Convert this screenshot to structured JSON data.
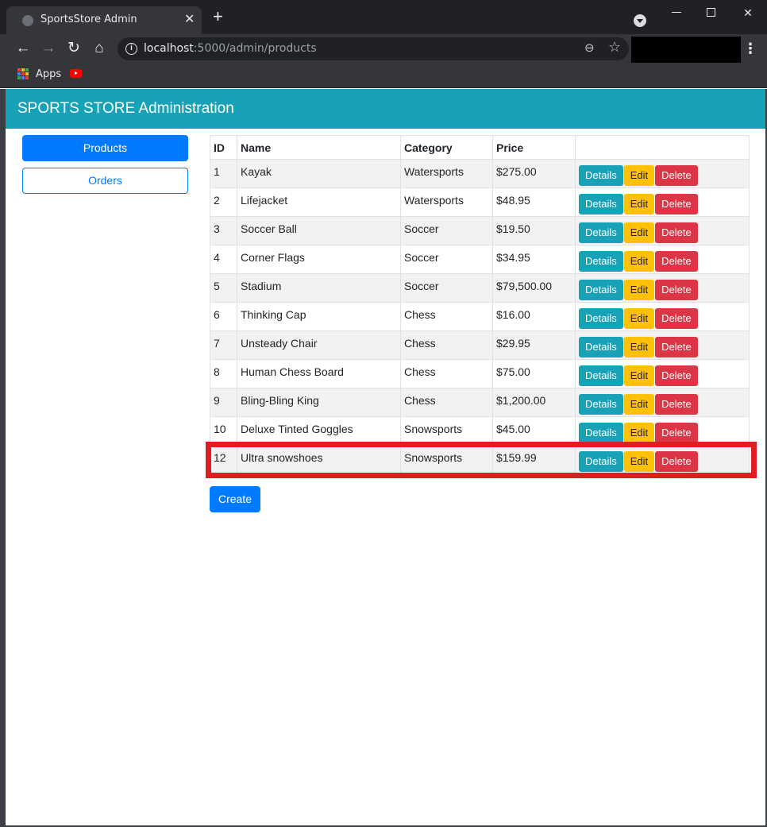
{
  "browser": {
    "tab_title": "SportsStore Admin",
    "tab_close": "✕",
    "new_tab": "+",
    "url_host": "localhost",
    "url_rest": ":5000/admin/products",
    "bookmarks": [
      {
        "label": "Apps",
        "icon": "apps-grid-icon"
      },
      {
        "label": "",
        "icon": "youtube-icon"
      }
    ]
  },
  "app": {
    "brand": "SPORTS STORE Administration",
    "colors": {
      "navbar": "#17a2b8",
      "primary": "#007bff",
      "info": "#17a2b8",
      "warning": "#ffc107",
      "danger": "#dc3545",
      "highlight": "#e11d24"
    }
  },
  "sidebar": {
    "products_label": "Products",
    "orders_label": "Orders"
  },
  "table": {
    "headers": {
      "id": "ID",
      "name": "Name",
      "category": "Category",
      "price": "Price"
    },
    "action_labels": {
      "details": "Details",
      "edit": "Edit",
      "delete": "Delete"
    },
    "rows": [
      {
        "id": "1",
        "name": "Kayak",
        "category": "Watersports",
        "price": "$275.00"
      },
      {
        "id": "2",
        "name": "Lifejacket",
        "category": "Watersports",
        "price": "$48.95"
      },
      {
        "id": "3",
        "name": "Soccer Ball",
        "category": "Soccer",
        "price": "$19.50"
      },
      {
        "id": "4",
        "name": "Corner Flags",
        "category": "Soccer",
        "price": "$34.95"
      },
      {
        "id": "5",
        "name": "Stadium",
        "category": "Soccer",
        "price": "$79,500.00"
      },
      {
        "id": "6",
        "name": "Thinking Cap",
        "category": "Chess",
        "price": "$16.00"
      },
      {
        "id": "7",
        "name": "Unsteady Chair",
        "category": "Chess",
        "price": "$29.95"
      },
      {
        "id": "8",
        "name": "Human Chess Board",
        "category": "Chess",
        "price": "$75.00"
      },
      {
        "id": "9",
        "name": "Bling-Bling King",
        "category": "Chess",
        "price": "$1,200.00"
      },
      {
        "id": "10",
        "name": "Deluxe Tinted Goggles",
        "category": "Snowsports",
        "price": "$45.00"
      },
      {
        "id": "12",
        "name": "Ultra snowshoes",
        "category": "Snowsports",
        "price": "$159.99"
      }
    ]
  },
  "create_label": "Create"
}
